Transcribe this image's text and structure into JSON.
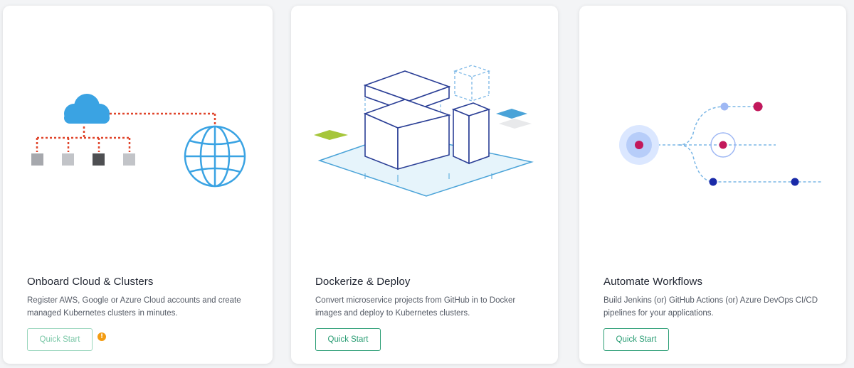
{
  "cards": [
    {
      "title": "Onboard Cloud & Clusters",
      "description": "Register AWS, Google or Azure Cloud accounts and create managed Kubernetes clusters in minutes.",
      "button_label": "Quick Start",
      "has_warning": true,
      "illustration": "cloud-clusters-icon"
    },
    {
      "title": "Dockerize & Deploy",
      "description": "Convert microservice projects from GitHub in to Docker images and deploy to Kubernetes clusters.",
      "button_label": "Quick Start",
      "has_warning": false,
      "illustration": "docker-deploy-icon"
    },
    {
      "title": "Automate Workflows",
      "description": "Build Jenkins (or) GitHub Actions (or) Azure DevOps CI/CD pipelines for your applications.",
      "button_label": "Quick Start",
      "has_warning": false,
      "illustration": "workflow-pipeline-icon"
    }
  ],
  "colors": {
    "accent": "#2a9d74",
    "warning": "#f39c12",
    "cloud_blue": "#3aa3e3",
    "line_red": "#e0452b",
    "dark_blue": "#2b3f96",
    "magenta": "#c2185b",
    "navy": "#1a2aa8"
  }
}
